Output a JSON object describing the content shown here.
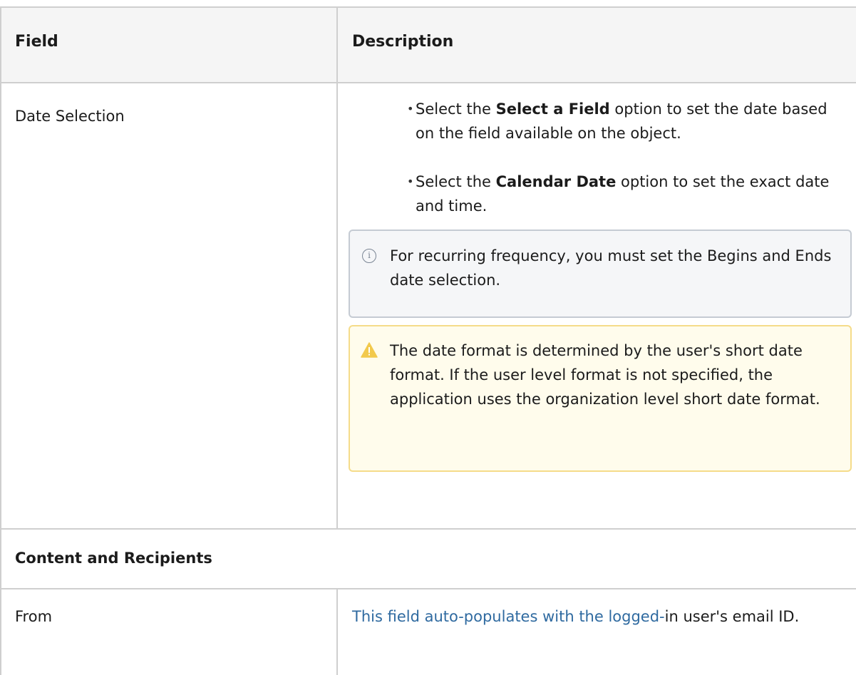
{
  "table": {
    "headers": [
      "Field",
      "Description"
    ],
    "rows": {
      "date_selection": {
        "field": "Date Selection",
        "bullets": [
          {
            "pre": "Select the ",
            "bold": "Select a Field",
            "post": " option to set the date based on the field available on the object."
          },
          {
            "pre": "Select the ",
            "bold": "Calendar Date",
            "post": " option to set the exact date and time."
          }
        ],
        "note": "For recurring frequency, you must set the Begins and Ends date selection.",
        "warning": "The date format is determined by the user's short date format. If the user level format is not specified, the application uses the organization level short date format."
      },
      "section": "Content and Recipients",
      "from": {
        "field": "From",
        "description_link": "This field auto-populates with the logged-",
        "description_rest": "in user's email ID."
      }
    }
  },
  "icons": {
    "note": "info-icon",
    "warning": "warning-icon"
  },
  "colors": {
    "header_bg": "#f5f5f5",
    "note_bg": "#f5f6f8",
    "warning_bg": "#fffcec",
    "warning_icon": "#f2c94c",
    "link": "#2f6aa0"
  }
}
